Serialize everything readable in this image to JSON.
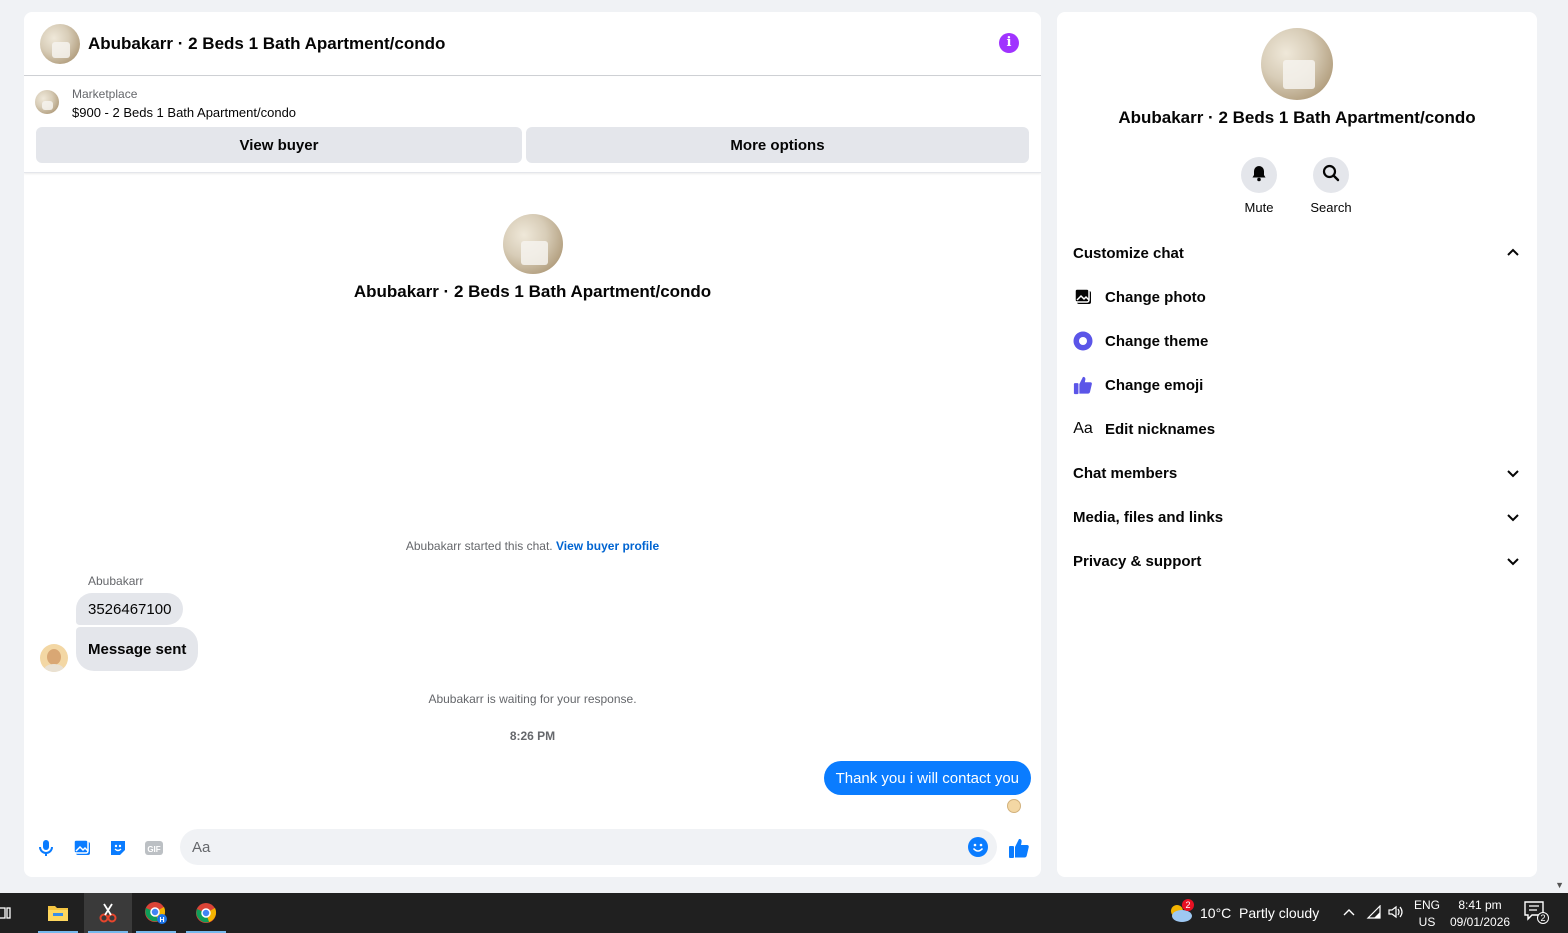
{
  "chat": {
    "header_title": "Abubakarr · 2 Beds 1 Bath Apartment/condo",
    "info_icon": "i",
    "marketplace_label": "Marketplace",
    "listing": "$900 - 2 Beds 1 Bath Apartment/condo",
    "view_buyer_label": "View buyer",
    "more_options_label": "More options",
    "intro_title": "Abubakarr · 2 Beds 1 Bath Apartment/condo",
    "started_text": "Abubakarr started this chat.",
    "view_profile_link": "View buyer profile",
    "sender_name": "Abubakarr",
    "messages_in": [
      "3526467100",
      "Message sent"
    ],
    "waiting_text": "Abubakarr is waiting for your response.",
    "timestamp": "8:26 PM",
    "message_out": "Thank you i will contact you",
    "composer_placeholder": "Aa",
    "accent_color": "#0a7cff"
  },
  "info_panel": {
    "title": "Abubakarr · 2 Beds 1 Bath Apartment/condo",
    "actions": [
      {
        "label": "Mute",
        "icon": "bell-icon"
      },
      {
        "label": "Search",
        "icon": "search-icon"
      }
    ],
    "sections": {
      "customize": "Customize chat",
      "customize_items": [
        {
          "label": "Change photo",
          "icon": "photo-icon"
        },
        {
          "label": "Change theme",
          "icon": "theme-icon"
        },
        {
          "label": "Change emoji",
          "icon": "thumbs-up-icon"
        },
        {
          "label": "Edit nicknames",
          "icon": "nickname-icon"
        }
      ],
      "members": "Chat members",
      "media": "Media, files and links",
      "privacy": "Privacy & support"
    },
    "nickname_glyph": "Aa"
  },
  "taskbar": {
    "weather": "10°C  Partly cloudy",
    "weather_badge": "2",
    "lang_top": "ENG",
    "lang_bottom": "US",
    "time": "8:41 pm",
    "date": "09/01/2026",
    "notification_count": "2"
  }
}
